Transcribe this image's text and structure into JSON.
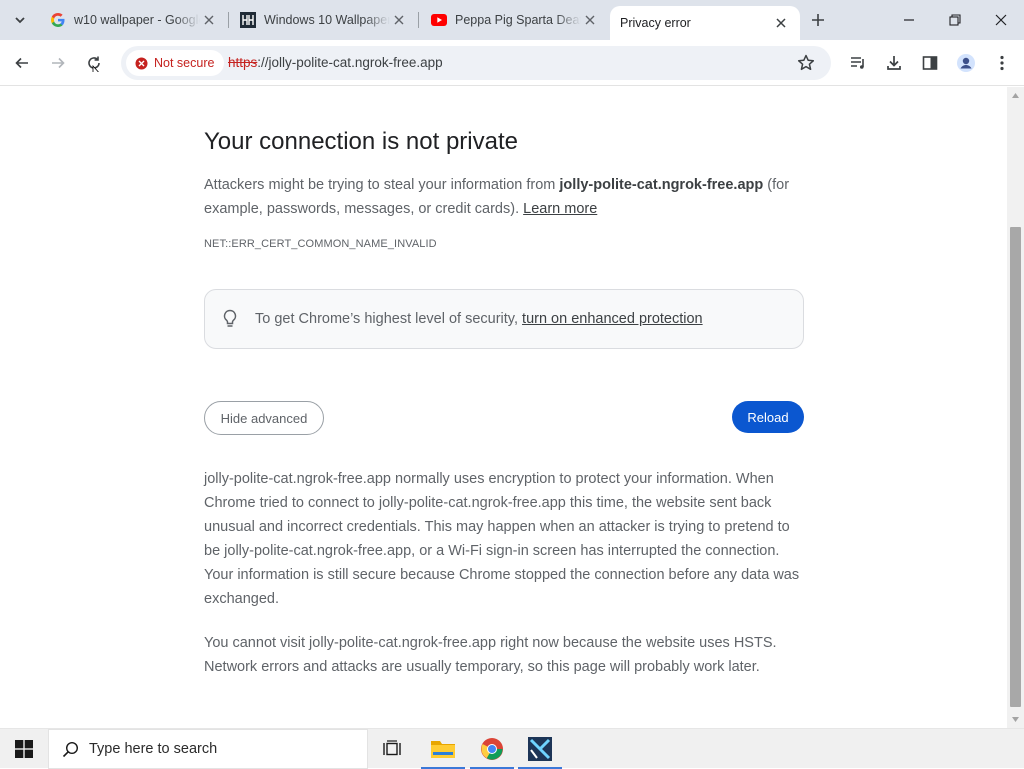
{
  "tabs": [
    {
      "title": "w10 wallpaper - Google Search",
      "favicon": "google-icon",
      "active": false
    },
    {
      "title": "Windows 10 Wallpapers",
      "favicon": "wallpapers-site-icon",
      "active": false
    },
    {
      "title": "Peppa Pig Sparta Death",
      "favicon": "youtube-icon",
      "active": false
    },
    {
      "title": "Privacy error",
      "favicon": "",
      "active": true
    }
  ],
  "toolbar": {
    "security_chip": "Not secure",
    "url_scheme": "https",
    "url_rest": "://jolly-polite-cat.ngrok-free.app"
  },
  "page": {
    "headline": "Your connection is not private",
    "intro_before": "Attackers might be trying to steal your information from ",
    "intro_host": "jolly-polite-cat.ngrok-free.app",
    "intro_after": " (for example, passwords, messages, or credit cards). ",
    "learn_more": "Learn more",
    "error_code": "NET::ERR_CERT_COMMON_NAME_INVALID",
    "enhanced_text": "To get Chrome’s highest level of security, ",
    "enhanced_link": "turn on enhanced protection",
    "hide_advanced": "Hide advanced",
    "reload": "Reload",
    "details_1": "jolly-polite-cat.ngrok-free.app normally uses encryption to protect your information. When Chrome tried to connect to jolly-polite-cat.ngrok-free.app this time, the website sent back unusual and incorrect credentials. This may happen when an attacker is trying to pretend to be jolly-polite-cat.ngrok-free.app, or a Wi-Fi sign-in screen has interrupted the connection. Your information is still secure because Chrome stopped the connection before any data was exchanged.",
    "details_2": "You cannot visit jolly-polite-cat.ngrok-free.app right now because the website uses HSTS. Network errors and attacks are usually temporary, so this page will probably work later."
  },
  "taskbar": {
    "search_placeholder": "Type here to search",
    "apps": [
      "task-view-icon",
      "file-explorer-icon",
      "chrome-icon",
      "app-icon"
    ]
  },
  "colors": {
    "tabstrip_bg": "#dee3eb",
    "omnibox_bg": "#eef1f6",
    "danger_red": "#c5221f",
    "reload_blue": "#0b57d0",
    "taskbar_bg": "#f0f0f0"
  }
}
